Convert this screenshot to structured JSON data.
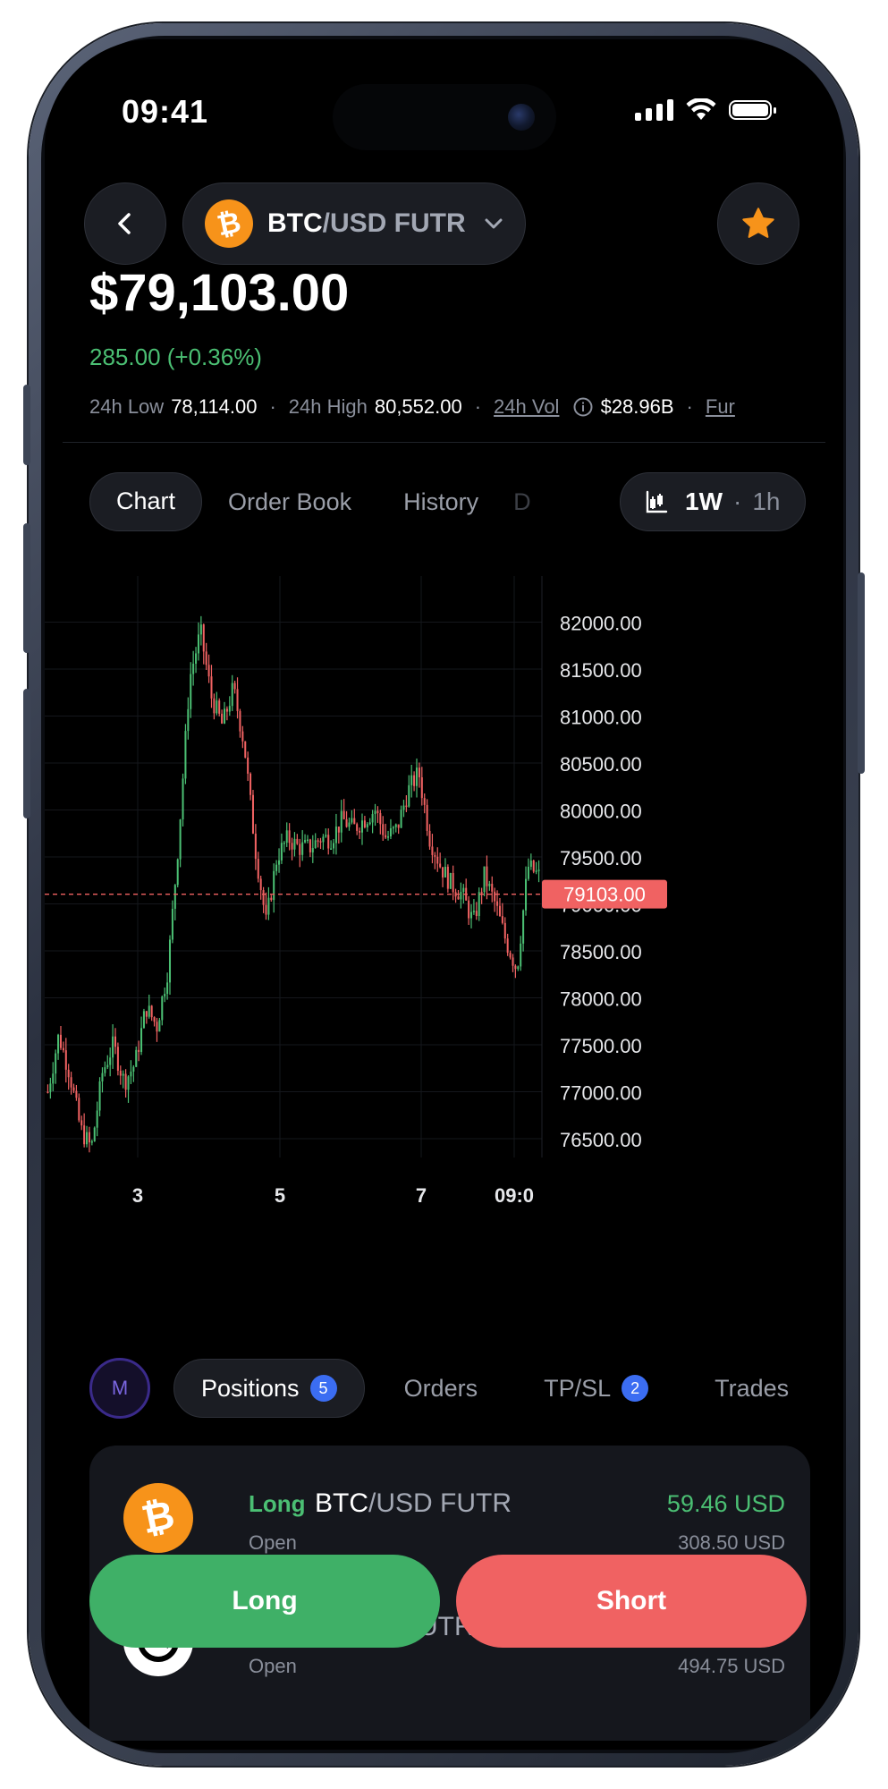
{
  "status_bar": {
    "time": "09:41"
  },
  "header": {
    "pair_base": "BTC",
    "pair_quote": "/USD FUTR",
    "btc_glyph": "₿",
    "icons": {
      "back": "chevron-left-icon",
      "dropdown": "chevron-down-icon",
      "favorite": "star-icon"
    }
  },
  "ticker": {
    "price": "$79,103.00",
    "change": "285.00 (+0.36%)",
    "low_label": "24h Low",
    "low_value": "78,114.00",
    "high_label": "24h High",
    "high_value": "80,552.00",
    "vol_label": "24h Vol",
    "vol_value": "$28.96B",
    "fund_label": "Fur",
    "sep": "·"
  },
  "tabs": [
    "Chart",
    "Order Book",
    "History",
    "D"
  ],
  "timeframe": {
    "range": "1W",
    "sep": "·",
    "interval": "1h"
  },
  "chart_data": {
    "type": "candlestick",
    "y_ticks": [
      "82000.00",
      "81500.00",
      "81000.00",
      "80500.00",
      "80000.00",
      "79500.00",
      "79000.00",
      "78500.00",
      "78000.00",
      "77500.00",
      "77000.00",
      "76500.00"
    ],
    "x_ticks": [
      "3",
      "5",
      "7",
      "09:0"
    ],
    "ylim": [
      76300,
      82300
    ],
    "last_price": 79103,
    "last_price_label": "79103.00",
    "up_color": "#4bbf73",
    "down_color": "#f06262",
    "path_close": [
      77000,
      77600,
      77200,
      76600,
      76400,
      77200,
      77500,
      77100,
      77300,
      77900,
      77700,
      78300,
      79700,
      81400,
      81900,
      81200,
      80900,
      81300,
      80700,
      79600,
      78800,
      79500,
      79700,
      79600,
      79600,
      79700,
      79700,
      79900,
      79800,
      79900,
      80000,
      79700,
      79800,
      80200,
      80400,
      79700,
      79400,
      79200,
      79100,
      78800,
      79300,
      79000,
      78600,
      78300,
      79400,
      79300
    ]
  },
  "bottom_tabs": {
    "badge": "M",
    "positions_label": "Positions",
    "positions_count": "5",
    "orders_label": "Orders",
    "tpsl_label": "TP/SL",
    "tpsl_count": "2",
    "trades_label": "Trades"
  },
  "positions": [
    {
      "side": "Long",
      "pair_base": "BTC",
      "pair_quote": "/USD FUTR",
      "status": "Open",
      "pnl": "59.46 USD",
      "value": "308.50 USD"
    },
    {
      "side": "",
      "pair_base": "",
      "pair_quote": "UTR",
      "status": "Open",
      "pnl": "",
      "value": "494.75 USD"
    }
  ],
  "actions": {
    "long": "Long",
    "short": "Short"
  }
}
